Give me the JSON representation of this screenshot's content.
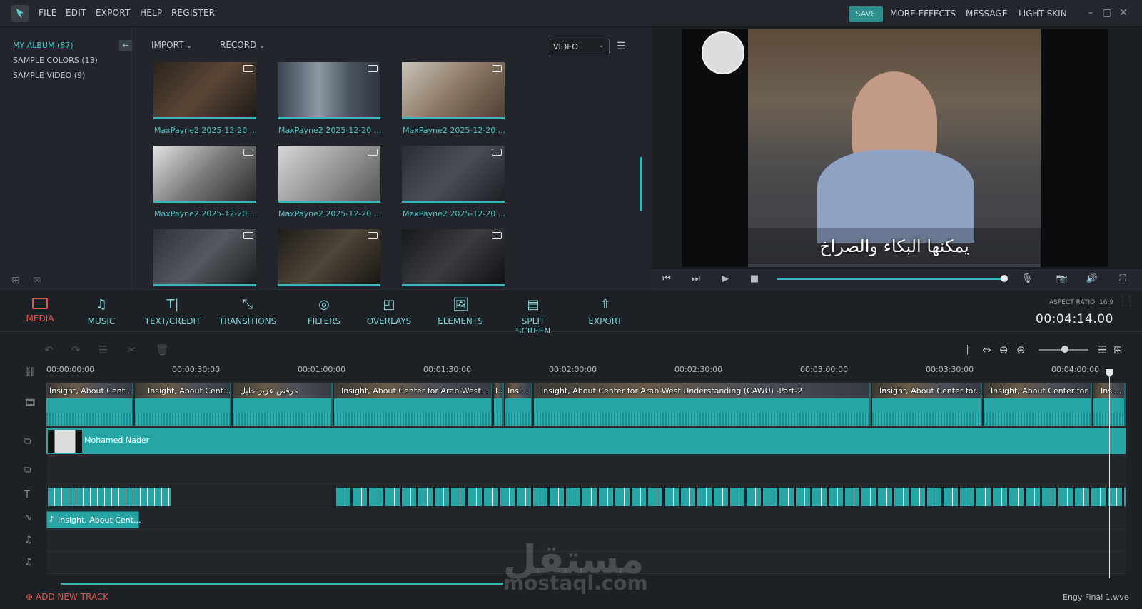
{
  "menubar": {
    "items": [
      "FILE",
      "EDIT",
      "EXPORT",
      "HELP",
      "REGISTER"
    ],
    "right": {
      "save": "SAVE",
      "more_effects": "MORE EFFECTS",
      "message": "MESSAGE",
      "light_skin": "LIGHT SKIN"
    }
  },
  "album": {
    "items": [
      "MY ALBUM (87)",
      "SAMPLE COLORS (13)",
      "SAMPLE VIDEO (9)"
    ]
  },
  "media_toolbar": {
    "import": "IMPORT",
    "record": "RECORD",
    "filter_value": "VIDEO"
  },
  "thumbnails": [
    "MaxPayne2 2025-12-20 ...",
    "MaxPayne2 2025-12-20 ...",
    "MaxPayne2 2025-12-20 ...",
    "MaxPayne2 2025-12-20 ...",
    "MaxPayne2 2025-12-20 ...",
    "MaxPayne2 2025-12-20 ..."
  ],
  "preview": {
    "subtitle": "يمكنها البكاء والصراخ"
  },
  "tools": [
    {
      "label": "MEDIA"
    },
    {
      "label": "MUSIC"
    },
    {
      "label": "TEXT/CREDIT"
    },
    {
      "label": "TRANSITIONS"
    },
    {
      "label": "FILTERS"
    },
    {
      "label": "OVERLAYS"
    },
    {
      "label": "ELEMENTS"
    },
    {
      "label": "SPLIT SCREEN"
    },
    {
      "label": "EXPORT"
    }
  ],
  "aspect_ratio": "ASPECT RATIO: 16:9",
  "timecode": "00:04:14.00",
  "ruler": [
    "00:00:00:00",
    "00:00:30:00",
    "00:01:00:00",
    "00:01:30:00",
    "00:02:00:00",
    "00:02:30:00",
    "00:03:00:00",
    "00:03:30:00",
    "00:04:00:00"
  ],
  "video_clips": [
    "Insight, About Cent...",
    "Insight, About Cent...",
    "مرقص عزيز خليل",
    "Insight, About Center for Arab-West...",
    "I...",
    "Insi...",
    "Insight, About Center for Arab-West Understanding (CAWU) -Part-2",
    "Insight, About Center for...",
    "Insight, About Center for ...",
    "Insi..."
  ],
  "pip_clip": "Mohamed Nader",
  "audio_clip": "Insight, About Cent...",
  "add_track": "ADD NEW TRACK",
  "project_name": "Engy Final 1.wve",
  "watermark": {
    "text": "مستقل",
    "url": "mostaql.com"
  },
  "colors": {
    "accent": "#3ab5b8",
    "clip": "#27a5a5",
    "active_tool": "#e0564d"
  }
}
